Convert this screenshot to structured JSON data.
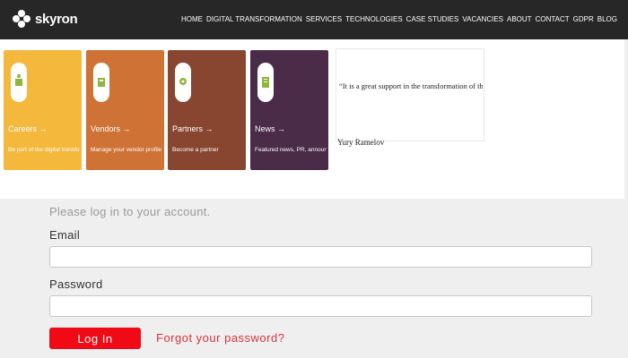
{
  "brand": {
    "name": "skyron"
  },
  "nav": {
    "items": [
      "HOME",
      "DIGITAL TRANSFORMATION",
      "SERVICES",
      "TECHNOLOGIES",
      "CASE STUDIES",
      "VACANCIES",
      "ABOUT",
      "CONTACT",
      "GDPR",
      "BLOG"
    ]
  },
  "cards": [
    {
      "title": "Careers →",
      "sub": "Be part of the digital transformation journey",
      "color": "#f4b83d",
      "icon": "careers-icon"
    },
    {
      "title": "Vendors →",
      "sub": "Manage your vendor profile",
      "color": "#cf7236",
      "icon": "vendors-icon"
    },
    {
      "title": "Partners →",
      "sub": "Become a partner",
      "color": "#884530",
      "icon": "partners-icon"
    },
    {
      "title": "News →",
      "sub": "Featured news, PR, announcements",
      "color": "#4a2b48",
      "icon": "news-icon"
    }
  ],
  "quote": {
    "line1": "“It is a great support in the transformation of the business, focused on agility and business value.",
    "line2": "Yury Ramelov"
  },
  "login": {
    "intro": "Please log in to your account.",
    "email_label": "Email",
    "email_value": "",
    "password_label": "Password",
    "password_value": "",
    "submit_label": "Log In",
    "forgot_label": "Forgot your password?"
  }
}
